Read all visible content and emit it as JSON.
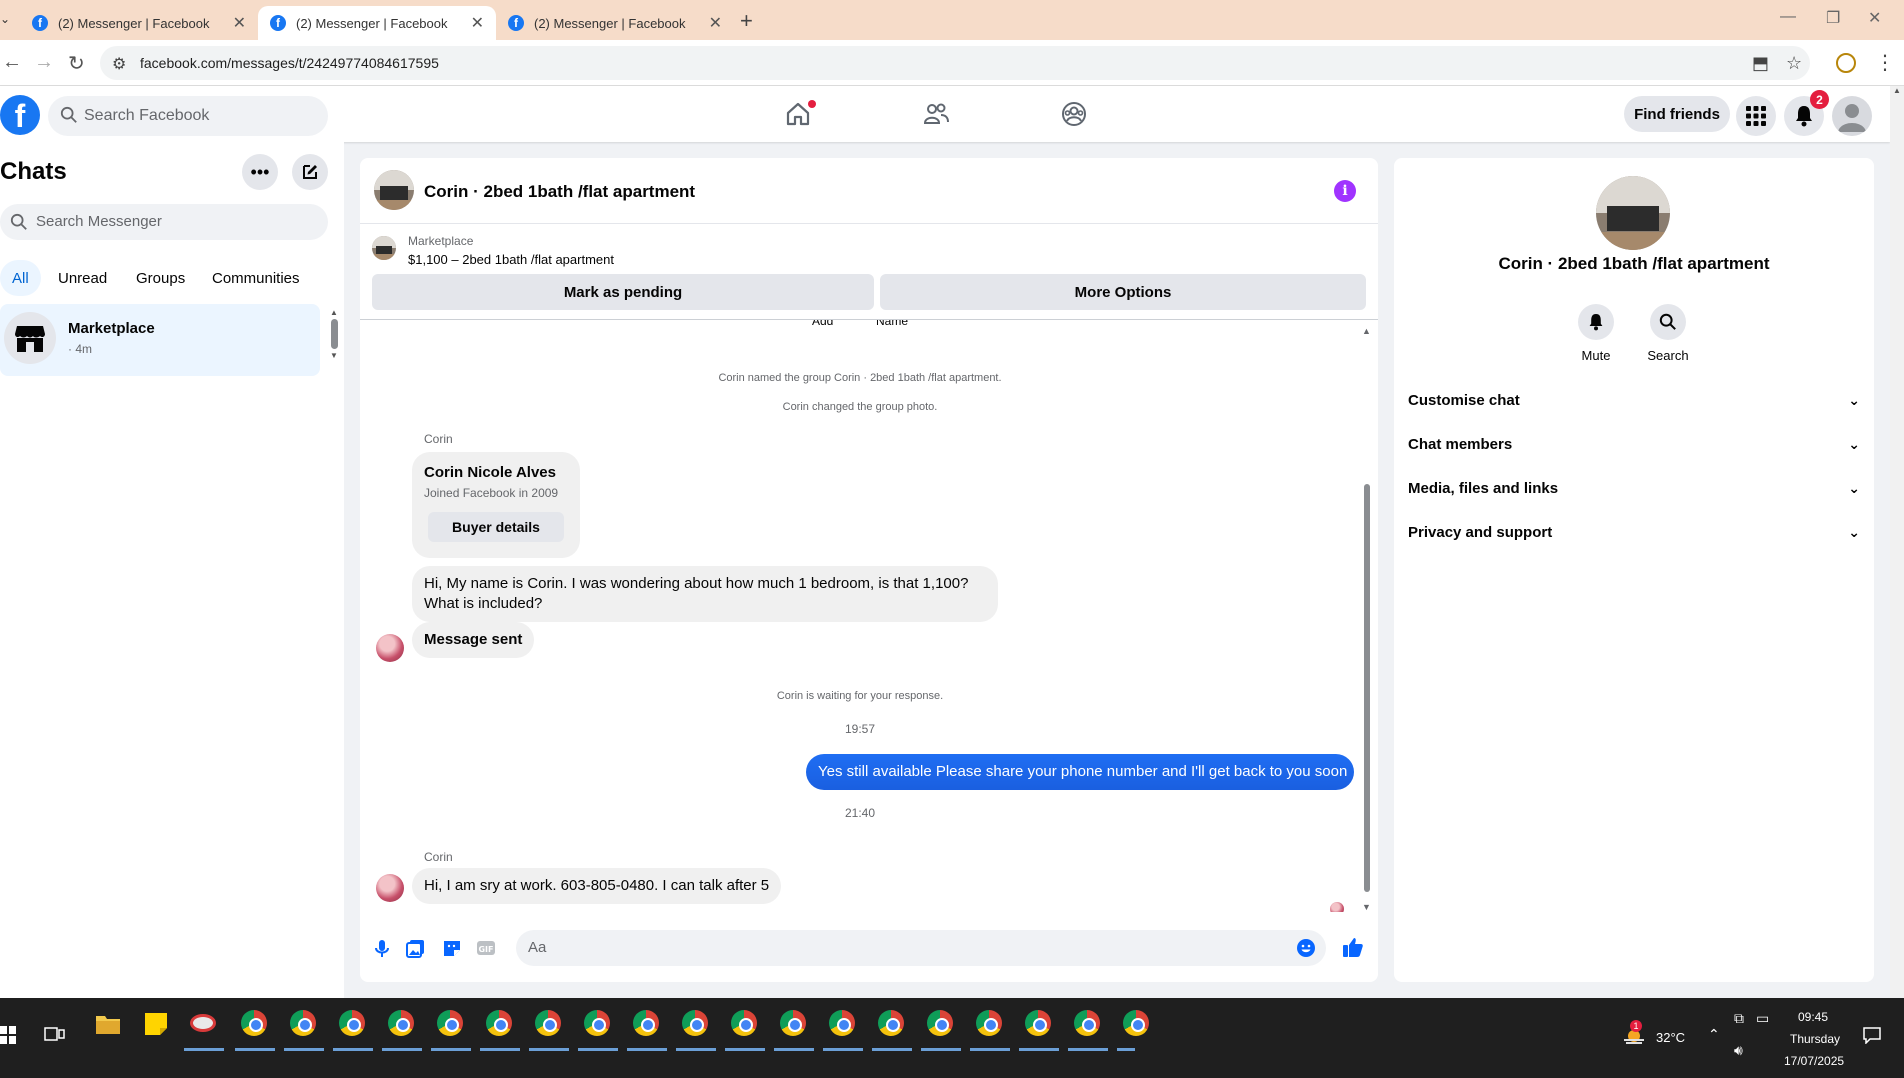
{
  "browser": {
    "tabs": [
      {
        "title": "(2) Messenger | Facebook",
        "active": false
      },
      {
        "title": "(2) Messenger | Facebook",
        "active": true
      },
      {
        "title": "(2) Messenger | Facebook",
        "active": false
      }
    ],
    "url": "facebook.com/messages/t/24249774084617595"
  },
  "header": {
    "search_placeholder": "Search Facebook",
    "find_friends": "Find friends",
    "notification_count": "2"
  },
  "sidebar": {
    "title": "Chats",
    "search_placeholder": "Search Messenger",
    "filters": [
      "All",
      "Unread",
      "Groups",
      "Communities"
    ],
    "active_filter": "All",
    "chats": [
      {
        "name": "Marketplace",
        "time": "· 4m"
      }
    ]
  },
  "conversation": {
    "title": "Corin · 2bed 1bath /flat apartment",
    "marketplace": {
      "label": "Marketplace",
      "listing": "$1,100 – 2bed 1bath /flat apartment",
      "mark_pending": "Mark as pending",
      "more_options": "More Options"
    },
    "top_partial": {
      "add": "Add",
      "name": "Name"
    },
    "system": {
      "named": "Corin named the group Corin · 2bed 1bath /flat apartment.",
      "photo": "Corin changed the group photo.",
      "waiting": "Corin is waiting for your response."
    },
    "sender_name": "Corin",
    "buyer": {
      "name": "Corin Nicole Alves",
      "joined": "Joined Facebook in 2009",
      "details_button": "Buyer details"
    },
    "messages": {
      "first": "Hi, My name is Corin. I was wondering about how much 1 bedroom, is that 1,100? What is included?",
      "sent_status": "Message sent",
      "reply": "Yes still available Please share your phone number and I'll get back to you soon",
      "last": "Hi, I am sry at work. 603-805-0480.  I can talk after 5"
    },
    "timestamps": {
      "first": "19:57",
      "second": "21:40"
    },
    "composer_placeholder": "Aa"
  },
  "details": {
    "name": "Corin · 2bed 1bath /flat apartment",
    "actions": {
      "mute": "Mute",
      "search": "Search"
    },
    "sections": [
      "Customise chat",
      "Chat members",
      "Media, files and links",
      "Privacy and support"
    ]
  },
  "taskbar": {
    "temperature": "32°C",
    "time": "09:45",
    "day": "Thursday",
    "date": "17/07/2025",
    "weather_badge": "1"
  },
  "colors": {
    "fb_blue": "#1877f2",
    "outgoing_bubble": "#1f6ef3",
    "info_purple": "#a033ff",
    "badge_red": "#e41e3f"
  }
}
